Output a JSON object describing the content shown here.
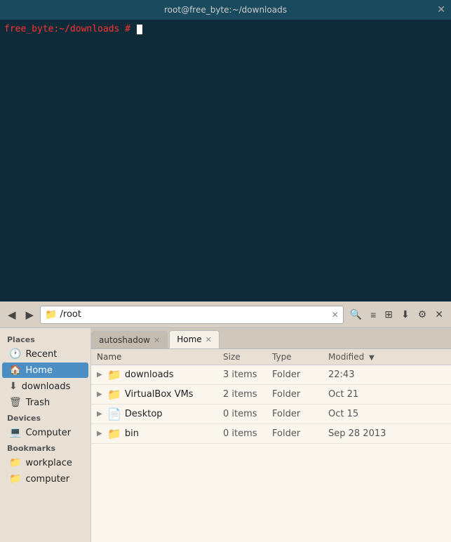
{
  "terminal": {
    "title": "root@free_byte:~/downloads",
    "close_label": "✕",
    "prompt": "free_byte:~/downloads # ",
    "cursor": true
  },
  "filemanager": {
    "toolbar": {
      "back_label": "◀",
      "forward_label": "▶",
      "location_icon": "📁",
      "location_text": "/root",
      "clear_label": "✕",
      "search_label": "🔍",
      "list_label": "≡",
      "grid_label": "⊞",
      "download_label": "⬇",
      "settings_label": "⚙",
      "close_label": "✕"
    },
    "tabs": [
      {
        "label": "autoshadow",
        "active": false,
        "closable": true
      },
      {
        "label": "Home",
        "active": true,
        "closable": true
      }
    ],
    "sidebar": {
      "sections": [
        {
          "header": "Places",
          "items": [
            {
              "icon": "🕐",
              "label": "Recent",
              "active": false
            },
            {
              "icon": "🏠",
              "label": "Home",
              "active": true
            },
            {
              "icon": "⬇",
              "label": "downloads",
              "active": false
            },
            {
              "icon": "🗑",
              "label": "Trash",
              "active": false
            }
          ]
        },
        {
          "header": "Devices",
          "items": [
            {
              "icon": "💻",
              "label": "Computer",
              "active": false
            }
          ]
        },
        {
          "header": "Bookmarks",
          "items": [
            {
              "icon": "📁",
              "label": "workplace",
              "active": false
            },
            {
              "icon": "📁",
              "label": "computer",
              "active": false
            }
          ]
        }
      ]
    },
    "table": {
      "columns": [
        {
          "label": "Name",
          "key": "name"
        },
        {
          "label": "Size",
          "key": "size"
        },
        {
          "label": "Type",
          "key": "type"
        },
        {
          "label": "Modified",
          "key": "modified",
          "sort": "desc"
        }
      ],
      "rows": [
        {
          "name": "downloads",
          "type_icon": "📁",
          "size": "3 items",
          "type": "Folder",
          "modified": "22:43",
          "expandable": true
        },
        {
          "name": "VirtualBox VMs",
          "type_icon": "📁",
          "size": "2 items",
          "type": "Folder",
          "modified": "Oct 21",
          "expandable": true
        },
        {
          "name": "Desktop",
          "type_icon": "📄",
          "size": "0 items",
          "type": "Folder",
          "modified": "Oct 15",
          "expandable": true
        },
        {
          "name": "bin",
          "type_icon": "📁",
          "size": "0 items",
          "type": "Folder",
          "modified": "Sep 28 2013",
          "expandable": true
        }
      ]
    }
  }
}
